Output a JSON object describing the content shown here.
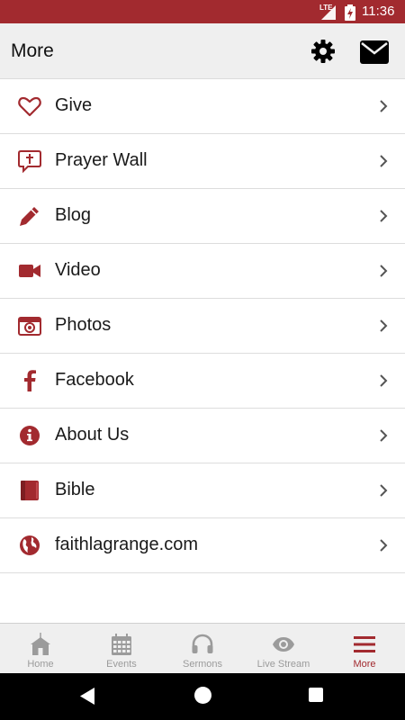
{
  "status_bar": {
    "network": "LTE",
    "time": "11:36"
  },
  "app_bar": {
    "title": "More"
  },
  "menu": {
    "items": [
      {
        "label": "Give",
        "icon": "heart-icon"
      },
      {
        "label": "Prayer Wall",
        "icon": "prayer-bubble-icon"
      },
      {
        "label": "Blog",
        "icon": "pencil-icon"
      },
      {
        "label": "Video",
        "icon": "video-camera-icon"
      },
      {
        "label": "Photos",
        "icon": "camera-icon"
      },
      {
        "label": "Facebook",
        "icon": "facebook-icon"
      },
      {
        "label": "About Us",
        "icon": "info-icon"
      },
      {
        "label": "Bible",
        "icon": "book-icon"
      },
      {
        "label": "faithlagrange.com",
        "icon": "globe-icon"
      }
    ]
  },
  "tab_bar": {
    "tabs": [
      {
        "label": "Home",
        "icon": "church-icon"
      },
      {
        "label": "Events",
        "icon": "calendar-icon"
      },
      {
        "label": "Sermons",
        "icon": "headphones-icon"
      },
      {
        "label": "Live Stream",
        "icon": "eye-icon"
      },
      {
        "label": "More",
        "icon": "menu-icon"
      }
    ],
    "active": "More"
  },
  "colors": {
    "accent": "#a22a2f",
    "inactive": "#9b9b9b",
    "app_bar_bg": "#efefef"
  }
}
